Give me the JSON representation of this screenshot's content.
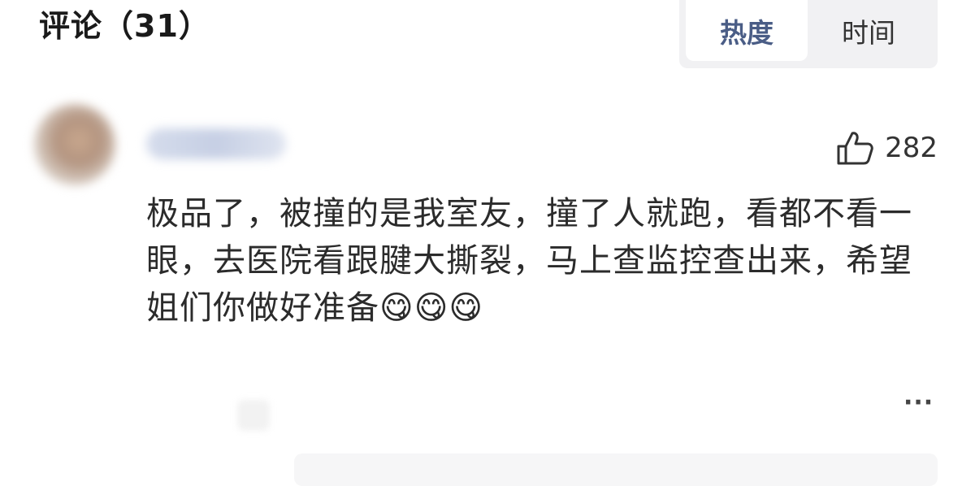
{
  "header": {
    "title": "评论（31）"
  },
  "sort": {
    "options": [
      {
        "label": "热度",
        "active": true
      },
      {
        "label": "时间",
        "active": false
      }
    ]
  },
  "comment": {
    "like_icon": "thumbs-up-icon",
    "like_count": "282",
    "text": "极品了，被撞的是我室友，撞了人就跑，看都不看一眼，去医院看跟腱大撕裂，马上查监控查出来，希望姐们你做好准备😋😋😋",
    "more_label": "···"
  },
  "colors": {
    "active_sort": "#4a5d86",
    "toggle_bg": "#f1f1f3"
  }
}
